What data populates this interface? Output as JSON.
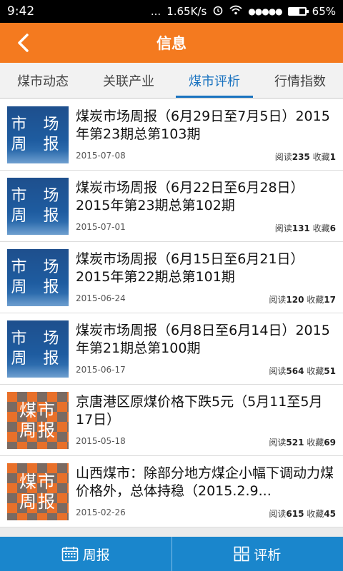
{
  "status_bar": {
    "time": "9:42",
    "speed": "1.65K/s",
    "dots": "...",
    "signal": "●●●●●",
    "battery": "65%",
    "battery_level": 0.65
  },
  "header": {
    "title": "信息"
  },
  "tabs": [
    {
      "label": "煤市动态",
      "active": false
    },
    {
      "label": "关联产业",
      "active": false
    },
    {
      "label": "煤市评析",
      "active": true
    },
    {
      "label": "行情指数",
      "active": false
    }
  ],
  "thumbs": {
    "blue": [
      "市 场",
      "周 报"
    ],
    "orange": [
      "煤市",
      "周报"
    ]
  },
  "stats_labels": {
    "read": "阅读",
    "fav": "收藏"
  },
  "items": [
    {
      "thumb": "blue",
      "title": "煤炭市场周报（6月29日至7月5日）2015年第23期总第103期",
      "date": "2015-07-08",
      "read": "235",
      "fav": "1"
    },
    {
      "thumb": "blue",
      "title": "煤炭市场周报（6月22日至6月28日）2015年第23期总第102期",
      "date": "2015-07-01",
      "read": "131",
      "fav": "6"
    },
    {
      "thumb": "blue",
      "title": "煤炭市场周报（6月15日至6月21日）2015年第22期总第101期",
      "date": "2015-06-24",
      "read": "120",
      "fav": "17"
    },
    {
      "thumb": "blue",
      "title": "煤炭市场周报（6月8日至6月14日）2015年第21期总第100期",
      "date": "2015-06-17",
      "read": "564",
      "fav": "51"
    },
    {
      "thumb": "orange",
      "title": "京唐港区原煤价格下跌5元（5月11至5月17日）",
      "date": "2015-05-18",
      "read": "521",
      "fav": "69"
    },
    {
      "thumb": "orange",
      "title": "山西煤市：除部分地方煤企小幅下调动力煤价格外，总体持稳（2015.2.9...",
      "date": "2015-02-26",
      "read": "615",
      "fav": "45"
    }
  ],
  "bottom": [
    {
      "label": "周报",
      "icon": "calendar-icon"
    },
    {
      "label": "评析",
      "icon": "grid-icon"
    }
  ]
}
